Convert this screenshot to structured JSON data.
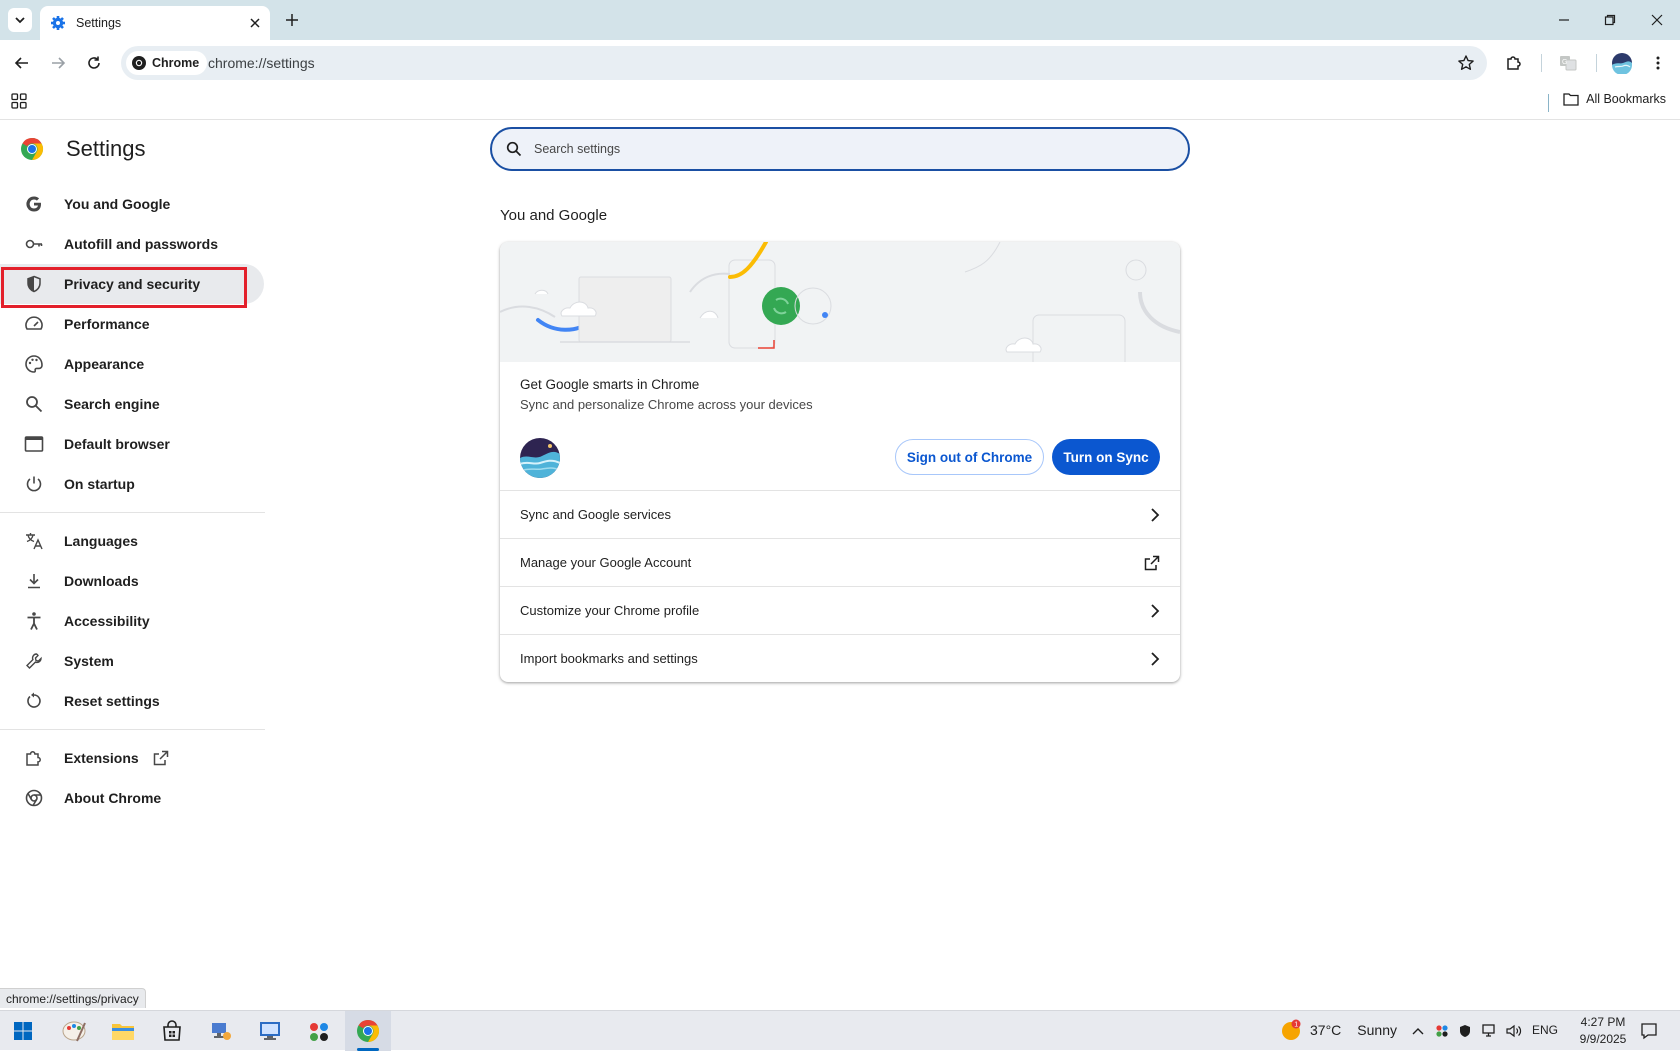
{
  "browser": {
    "tab_title": "Settings",
    "url_chip": "Chrome",
    "url": "chrome://settings",
    "all_bookmarks": "All Bookmarks",
    "status_url": "chrome://settings/privacy"
  },
  "sidebar": {
    "title": "Settings",
    "items": [
      {
        "label": "You and Google",
        "icon": "google-g-icon"
      },
      {
        "label": "Autofill and passwords",
        "icon": "key-icon"
      },
      {
        "label": "Privacy and security",
        "icon": "shield-icon",
        "active": true
      },
      {
        "label": "Performance",
        "icon": "speedometer-icon"
      },
      {
        "label": "Appearance",
        "icon": "palette-icon"
      },
      {
        "label": "Search engine",
        "icon": "search-icon"
      },
      {
        "label": "Default browser",
        "icon": "browser-window-icon"
      },
      {
        "label": "On startup",
        "icon": "power-icon"
      },
      {
        "label": "Languages",
        "icon": "translate-icon"
      },
      {
        "label": "Downloads",
        "icon": "download-icon"
      },
      {
        "label": "Accessibility",
        "icon": "accessibility-icon"
      },
      {
        "label": "System",
        "icon": "wrench-icon"
      },
      {
        "label": "Reset settings",
        "icon": "reset-icon"
      },
      {
        "label": "Extensions",
        "icon": "puzzle-icon"
      },
      {
        "label": "About Chrome",
        "icon": "chrome-icon"
      }
    ]
  },
  "main": {
    "search_placeholder": "Search settings",
    "section_title": "You and Google",
    "promo_title": "Get Google smarts in Chrome",
    "promo_subtitle": "Sync and personalize Chrome across your devices",
    "sign_out_label": "Sign out of Chrome",
    "turn_on_sync_label": "Turn on Sync",
    "rows": [
      {
        "label": "Sync and Google services",
        "icon": "chevron-right-icon"
      },
      {
        "label": "Manage your Google Account",
        "icon": "external-link-icon"
      },
      {
        "label": "Customize your Chrome profile",
        "icon": "chevron-right-icon"
      },
      {
        "label": "Import bookmarks and settings",
        "icon": "chevron-right-icon"
      }
    ]
  },
  "taskbar": {
    "temperature": "37°C",
    "weather": "Sunny",
    "weather_badge": "1",
    "language": "ENG",
    "time": "4:27 PM",
    "date": "9/9/2025"
  },
  "colors": {
    "accent": "#0b57d0",
    "highlight_box": "#e3202b",
    "tabstrip": "#d3e3e9"
  }
}
